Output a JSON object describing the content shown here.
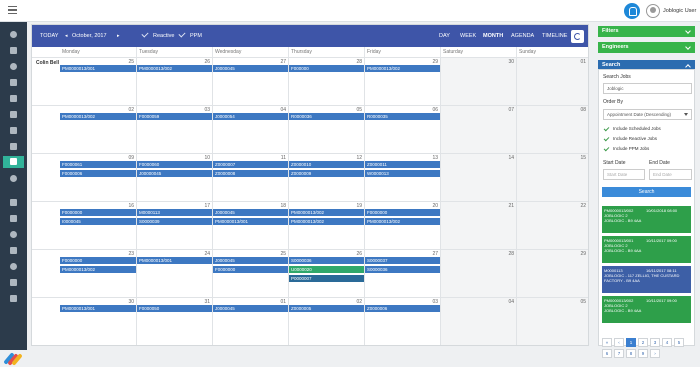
{
  "header": {
    "user_label": "Joblogic User"
  },
  "toolbar": {
    "today": "TODAY",
    "month_label": "October, 2017",
    "reactive_label": "Reactive",
    "ppm_label": "PPM",
    "views": [
      "DAY",
      "WEEK",
      "MONTH",
      "AGENDA",
      "TIMELINE"
    ],
    "active_view": "MONTH"
  },
  "calendar": {
    "day_headers": [
      "Monday",
      "Tuesday",
      "Wednesday",
      "Thursday",
      "Friday",
      "Saturday",
      "Sunday"
    ],
    "resource": "Colin Bell",
    "weeks": [
      {
        "days": [
          "25",
          "26",
          "27",
          "28",
          "29",
          "30",
          "01"
        ],
        "events": [
          [
            "PM0000013/001"
          ],
          [
            "PM0000013/002"
          ],
          [
            "J0000045"
          ],
          [
            "F000000"
          ],
          [
            "PM0000013/002"
          ],
          [],
          []
        ]
      },
      {
        "days": [
          "02",
          "03",
          "04",
          "05",
          "06",
          "07",
          "08"
        ],
        "events": [
          [
            "PM0000013/002"
          ],
          [
            "F0000059"
          ],
          [
            "J0000054"
          ],
          [
            "R0000036"
          ],
          [
            "R0000035"
          ],
          [],
          []
        ]
      },
      {
        "days": [
          "09",
          "10",
          "11",
          "12",
          "13",
          "14",
          "15"
        ],
        "events": [
          [
            "F0000061",
            "F0000006"
          ],
          [
            "F0000060",
            "J00000045"
          ],
          [
            "Z0000007",
            "Z0000008"
          ],
          [
            "Z0000010",
            "Z0000009"
          ],
          [
            "Z0000011",
            "W0000013"
          ],
          [],
          []
        ]
      },
      {
        "days": [
          "16",
          "17",
          "18",
          "19",
          "20",
          "21",
          "22"
        ],
        "events": [
          [
            "F0000000",
            "I0000045"
          ],
          [
            "M0000113",
            "S0000039"
          ],
          [
            "J0000045",
            "PM0000013/001"
          ],
          [
            "PM0000013/002",
            "PM0000013/002"
          ],
          [
            "F0000000",
            "PM0000013/002"
          ],
          [],
          []
        ]
      },
      {
        "days": [
          "23",
          "24",
          "25",
          "26",
          "27",
          "28",
          "29"
        ],
        "events": [
          [
            "F0000000",
            "PM0000013/002"
          ],
          [
            "PM0000013/001"
          ],
          [
            "J0000045",
            "F0000000"
          ],
          [
            "S0000036",
            "U0000020",
            "P0000007"
          ],
          [
            "S0000037",
            "S0000036"
          ],
          [],
          []
        ]
      },
      {
        "days": [
          "30",
          "31",
          "01",
          "02",
          "03",
          "04",
          "05"
        ],
        "events": [
          [
            "PM0000013/001"
          ],
          [
            "F0000050"
          ],
          [
            "J0000045"
          ],
          [
            "Z0000005"
          ],
          [
            "Z0000006"
          ],
          [],
          []
        ]
      }
    ]
  },
  "panel": {
    "filters": "Filters",
    "engineers": "Engineers",
    "search": "Search",
    "search_jobs_label": "Search Jobs",
    "search_jobs_value": "Joblogic",
    "order_by_label": "Order By",
    "order_by_value": "Appointment Date (Descending)",
    "checks": [
      "Include Scheduled Jobs",
      "Include Reactive Jobs",
      "Include PPM Jobs"
    ],
    "start_date_label": "Start Date",
    "end_date_label": "End Date",
    "start_date_placeholder": "Start Date",
    "end_date_placeholder": "End Date",
    "search_button": "Search",
    "results": [
      {
        "ref": "PM0000013/002",
        "date": "10/01/2018 08:00",
        "l2": "JOBLOGIC 2",
        "l3": "JOBLOGIC - B9 4AA",
        "color": "green"
      },
      {
        "ref": "PM0000013/001",
        "date": "10/11/2017 09:00",
        "l2": "JOBLOGIC 2",
        "l3": "JOBLOGIC - B9 4AA",
        "color": "green"
      },
      {
        "ref": "M0000113",
        "date": "16/11/2017 08:11",
        "l2": "JOBLOGIC - 117 ZELLIG, THE CUSTARD",
        "l3": "FACTORY - B9 4AA",
        "color": "blue"
      },
      {
        "ref": "PM0000013/002",
        "date": "10/11/2017 09:00",
        "l2": "JOBLOGIC 2",
        "l3": "JOBLOGIC - B9 4AA",
        "color": "green"
      }
    ],
    "pager": [
      "«",
      "‹",
      "1",
      "2",
      "3",
      "4",
      "5",
      "6",
      "7",
      "8",
      "9",
      "›"
    ]
  }
}
